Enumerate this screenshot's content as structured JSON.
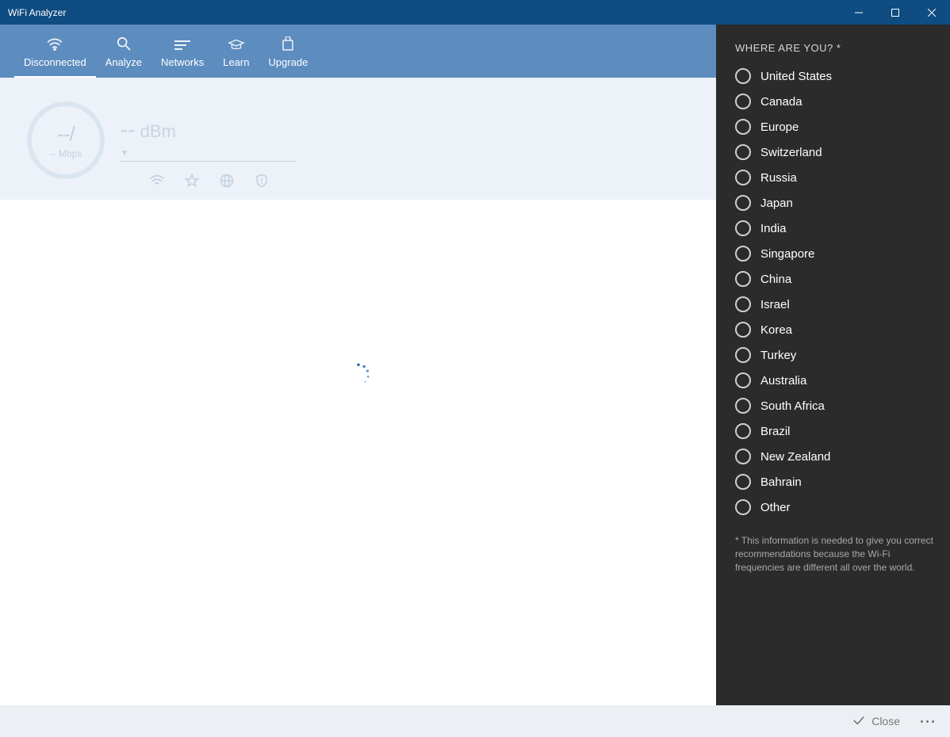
{
  "window": {
    "title": "WiFi Analyzer"
  },
  "toolbar": {
    "tabs": [
      {
        "label": "Disconnected"
      },
      {
        "label": "Analyze"
      },
      {
        "label": "Networks"
      },
      {
        "label": "Learn"
      },
      {
        "label": "Upgrade"
      }
    ],
    "active_index": 0
  },
  "gauge": {
    "major": "--/",
    "minor": "-- Mbps",
    "dbm_value": "--",
    "dbm_unit": "dBm"
  },
  "side_panel": {
    "title": "WHERE ARE YOU? *",
    "options": [
      "United States",
      "Canada",
      "Europe",
      "Switzerland",
      "Russia",
      "Japan",
      "India",
      "Singapore",
      "China",
      "Israel",
      "Korea",
      "Turkey",
      "Australia",
      "South Africa",
      "Brazil",
      "New Zealand",
      "Bahrain",
      "Other"
    ],
    "disclaimer": "* This information is needed to give you correct recommendations because the Wi-Fi frequencies are different all over the world."
  },
  "footer": {
    "close_label": "Close"
  }
}
